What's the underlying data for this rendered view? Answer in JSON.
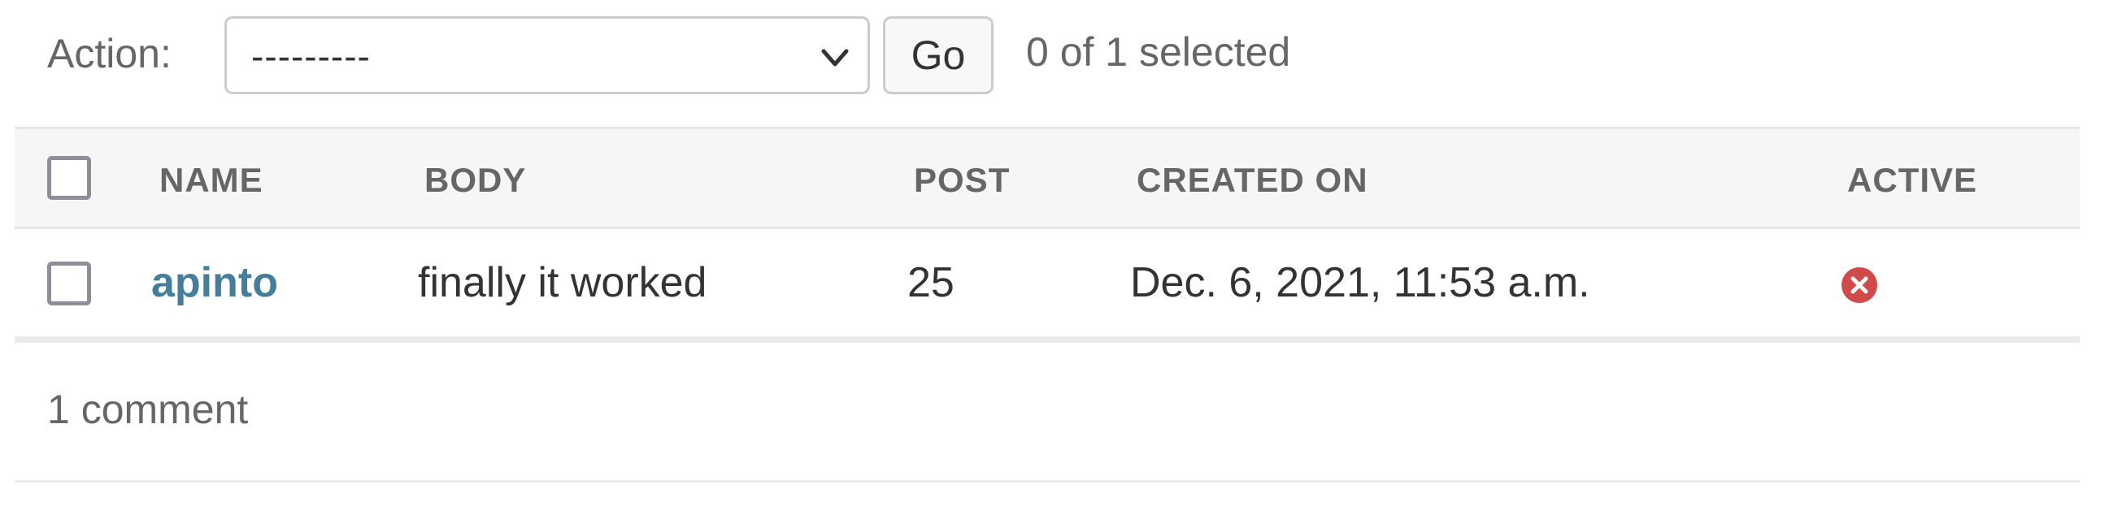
{
  "actions": {
    "label": "Action:",
    "select_value": "---------",
    "go_label": "Go",
    "selected_count": "0 of 1 selected"
  },
  "table": {
    "columns": [
      "NAME",
      "BODY",
      "POST",
      "CREATED ON",
      "ACTIVE"
    ],
    "rows": [
      {
        "name": "apinto",
        "body": "finally it worked",
        "post": "25",
        "created_on": "Dec. 6, 2021, 11:53 a.m.",
        "active": false,
        "active_icon": "inactive-x-circle-icon"
      }
    ]
  },
  "paginator": {
    "count_text": "1 comment"
  },
  "colors": {
    "link": "#447e9b",
    "inactive": "#d04a4a",
    "header_bg": "#f6f6f6"
  }
}
